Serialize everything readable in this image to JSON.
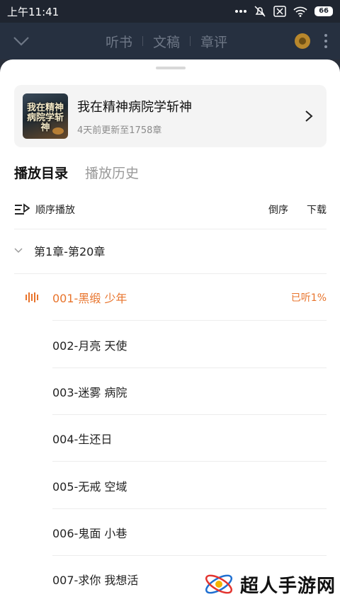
{
  "status": {
    "time": "上午11:41",
    "battery": "66",
    "icons": [
      "more-dots-icon",
      "mute-icon",
      "sim-off-icon",
      "wifi-icon",
      "battery-icon"
    ]
  },
  "topbar": {
    "tabs": [
      "听书",
      "文稿",
      "章评"
    ]
  },
  "book": {
    "title": "我在精神病院学斩神",
    "update_info": "4天前更新至1758章",
    "cover_text": "我在精神病院学斩神"
  },
  "list_tabs": {
    "active": "播放目录",
    "inactive": "播放历史"
  },
  "toolbar": {
    "sequence": "顺序播放",
    "reverse": "倒序",
    "download": "下载"
  },
  "volume": {
    "label": "第1章-第20章"
  },
  "chapters": [
    {
      "title": "001-黑缎 少年",
      "progress": "已听1%"
    },
    {
      "title": "002-月亮 天使"
    },
    {
      "title": "003-迷雾 病院"
    },
    {
      "title": "004-生还日"
    },
    {
      "title": "005-无戒 空域"
    },
    {
      "title": "006-鬼面 小巷"
    },
    {
      "title": "007-求你 我想活"
    }
  ],
  "watermark": {
    "text": "超人手游网"
  },
  "colors": {
    "accent": "#e8742c",
    "overlay_bg": "#263040"
  }
}
